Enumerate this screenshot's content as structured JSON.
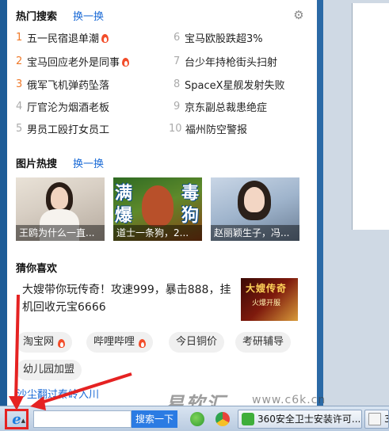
{
  "hot_search": {
    "title": "热门搜索",
    "switch_label": "换一换",
    "items": [
      {
        "num": "1",
        "text": "五一民宿退单潮",
        "hot": true
      },
      {
        "num": "2",
        "text": "宝马回应老外是同事",
        "hot": true
      },
      {
        "num": "3",
        "text": "俄军飞机弹药坠落",
        "hot": false
      },
      {
        "num": "4",
        "text": "厅官沦为烟酒老板",
        "hot": false
      },
      {
        "num": "5",
        "text": "男员工殴打女员工",
        "hot": false
      },
      {
        "num": "6",
        "text": "宝马欧股跌超3%",
        "hot": false
      },
      {
        "num": "7",
        "text": "台少年持枪街头扫射",
        "hot": false
      },
      {
        "num": "8",
        "text": "SpaceX星舰发射失败",
        "hot": false
      },
      {
        "num": "9",
        "text": "京东副总裁患绝症",
        "hot": false
      },
      {
        "num": "10",
        "text": "福州防空警报",
        "hot": false
      }
    ]
  },
  "picture_search": {
    "title": "图片热搜",
    "switch_label": "换一换",
    "items": [
      {
        "caption": "王鸥为什么一直..."
      },
      {
        "caption": "道士一条狗，2..."
      },
      {
        "caption": "赵丽颖生子，冯..."
      }
    ],
    "pic2_overlay": [
      "满",
      "爆",
      "毒",
      "狗"
    ]
  },
  "guess": {
    "title": "猜你喜欢",
    "ad_text": "大嫂带你玩传奇！攻速999，暴击888，挂机回收元宝6666",
    "ad_thumb_title": "大嫂传奇",
    "ad_thumb_sub": "火爆开服"
  },
  "tags": [
    {
      "label": "淘宝网",
      "hot": true
    },
    {
      "label": "哔哩哔哩",
      "hot": true
    },
    {
      "label": "今日铜价",
      "hot": false
    },
    {
      "label": "考研辅导",
      "hot": false
    },
    {
      "label": "幼儿园加盟",
      "hot": false
    }
  ],
  "more_link": "沙尘翻过秦岭入川",
  "taskbar": {
    "search_button": "搜索一下",
    "task_360": "360安全卫士安装许可...",
    "task_doc": "3"
  },
  "watermark": {
    "text": "易软汇",
    "url": "www.c6k.cn"
  },
  "colors": {
    "accent_blue": "#1a6ad6",
    "rank_top": "#f07a2a",
    "hot_fire": "#f24d2a",
    "annotation_red": "#e52222"
  }
}
